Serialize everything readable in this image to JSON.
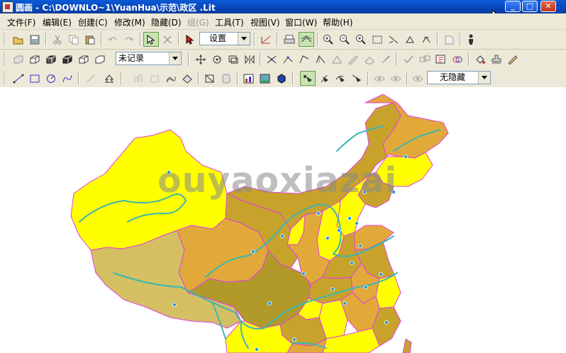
{
  "window": {
    "title": "圆画 - C:\\DOWNLO~1\\YuanHua\\示范\\政区 .Lit",
    "minimize": "_",
    "maximize": "□",
    "close": "✕"
  },
  "menu": [
    "文件(F)",
    "编辑(E)",
    "创建(C)",
    "修改(M)",
    "隐藏(D)",
    "组(G)",
    "工具(T)",
    "视图(V)",
    "窗口(W)",
    "帮助(H)"
  ],
  "toolbar1": {
    "mode_combo": "设置",
    "icons": [
      "open-icon",
      "save-icon",
      "cut-icon",
      "copy-icon",
      "paste-icon",
      "undo-icon",
      "redo-icon",
      "select-arrow-icon",
      "delete-x-icon",
      "pointer-icon",
      "axis-icon",
      "print-icon",
      "layer-icon",
      "zoom-in-icon",
      "zoom-out-icon",
      "zoom-area-icon",
      "fit-icon",
      "pan-icon",
      "rotate-icon",
      "refresh-icon",
      "move-icon",
      "person-icon"
    ]
  },
  "toolbar2": {
    "record_combo": "未记录",
    "icons": [
      "cube-1-icon",
      "cube-2-icon",
      "cube-3-icon",
      "cube-4-icon",
      "cube-5-icon",
      "move-cross-icon",
      "rotate-icon",
      "scale-icon",
      "mirror-icon",
      "vertex-icon",
      "edge-icon",
      "angle-icon",
      "measure-icon",
      "triangle-icon",
      "pen-icon",
      "eraser-icon",
      "brush-icon",
      "check-icon",
      "link-icon",
      "text-icon",
      "orbit-icon",
      "fill-icon",
      "stamp-icon",
      "ruler-icon"
    ]
  },
  "toolbar3": {
    "hide_combo": "无隐藏",
    "icons": [
      "line-icon",
      "rect-icon",
      "circle-icon",
      "curve-icon",
      "polyline-icon",
      "tree-icon",
      "grid-1-icon",
      "grid-2-icon",
      "wave-icon",
      "shape-icon",
      "diagonal-icon",
      "cylinder-icon",
      "chart-icon",
      "image-icon",
      "globe-icon",
      "point-a-icon",
      "point-b-icon",
      "point-c-icon",
      "point-d-icon",
      "eye-1-icon",
      "eye-2-icon",
      "eye-3-icon"
    ]
  },
  "map": {
    "watermark": "ouyaoxiazai",
    "colors": {
      "yellow": "#ffff00",
      "olive": "#c8a32c",
      "dark_olive": "#b29a2a",
      "orange": "#e1a93a",
      "light_olive": "#d4c062",
      "boundary": "#e040e0",
      "river": "#3bb7b0",
      "capital_marker": "#1d9bd8"
    }
  }
}
